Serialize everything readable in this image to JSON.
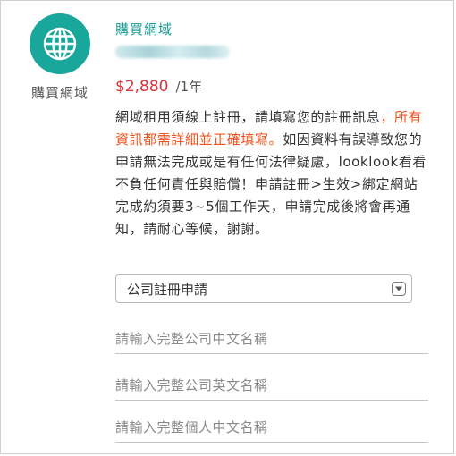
{
  "product": {
    "icon": "globe-icon",
    "icon_color": "#1aa79b",
    "name": "購買網域",
    "title": "購買網域",
    "price": "$2,880",
    "period": "/1年"
  },
  "description": {
    "line1": "網域租用須線上註冊，請填寫您的註冊訊息",
    "highlight": "，所有資訊都需詳細並正確填寫。",
    "line2": "如因資料有誤導致您的申請無法完成或是有任何法律疑慮，looklook看看不負任何責任與賠償！申請註冊>生效>綁定網站完成約須要3~5個工作天，申請完成後將會再通知，請耐心等候，謝謝。"
  },
  "form": {
    "type_select": {
      "value": "公司註冊申請"
    },
    "fields": [
      {
        "placeholder": "請輸入完整公司中文名稱"
      },
      {
        "placeholder": "請輸入完整公司英文名稱"
      },
      {
        "placeholder": "請輸入完整個人中文名稱"
      }
    ]
  },
  "colors": {
    "accent": "#1a9c95",
    "price": "#d9333e",
    "highlight": "#f0521c"
  }
}
